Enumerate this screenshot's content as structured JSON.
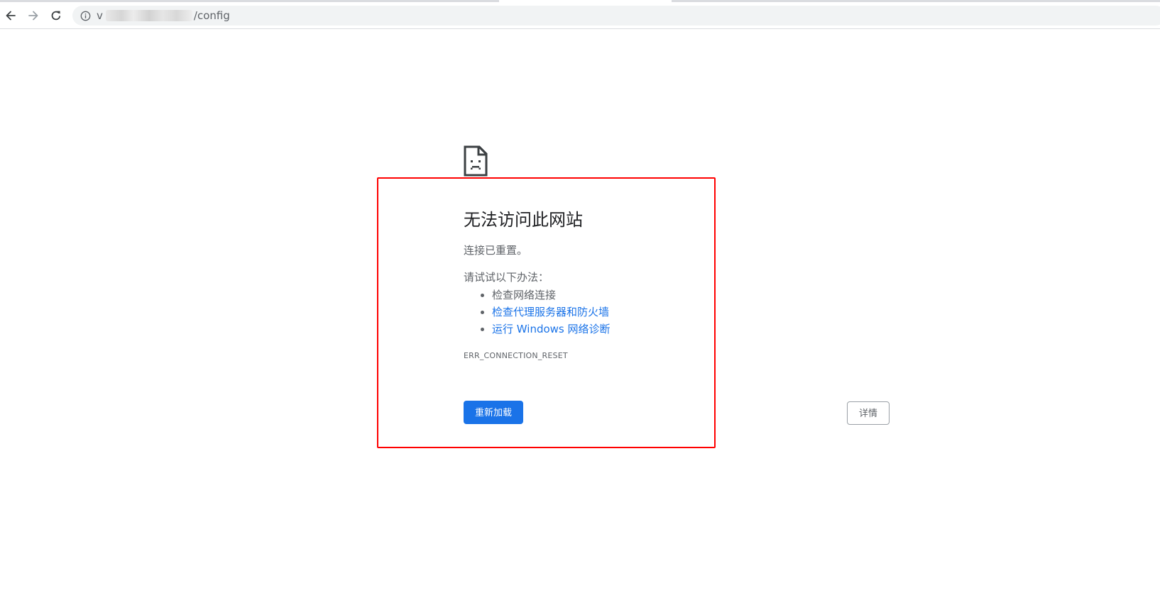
{
  "browser": {
    "omnibox": {
      "host_prefix": "v",
      "path": "/config"
    },
    "icons": {
      "back": "back-arrow-icon",
      "forward": "forward-arrow-icon",
      "reload": "reload-icon",
      "info": "info-icon"
    }
  },
  "error_page": {
    "icon": "sad-document-icon",
    "heading": "无法访问此网站",
    "summary": "连接已重置。",
    "suggestions_heading": "请试试以下办法：",
    "suggestions": [
      {
        "label": "检查网络连接",
        "link": false
      },
      {
        "label": "检查代理服务器和防火墙",
        "link": true
      },
      {
        "label": "运行 Windows 网络诊断",
        "link": true
      }
    ],
    "error_code": "ERR_CONNECTION_RESET",
    "reload_button": "重新加载",
    "details_button": "详情"
  },
  "colors": {
    "primary_blue": "#1a73e8",
    "text_secondary": "#5f6368",
    "highlight_red": "#ff0000"
  }
}
